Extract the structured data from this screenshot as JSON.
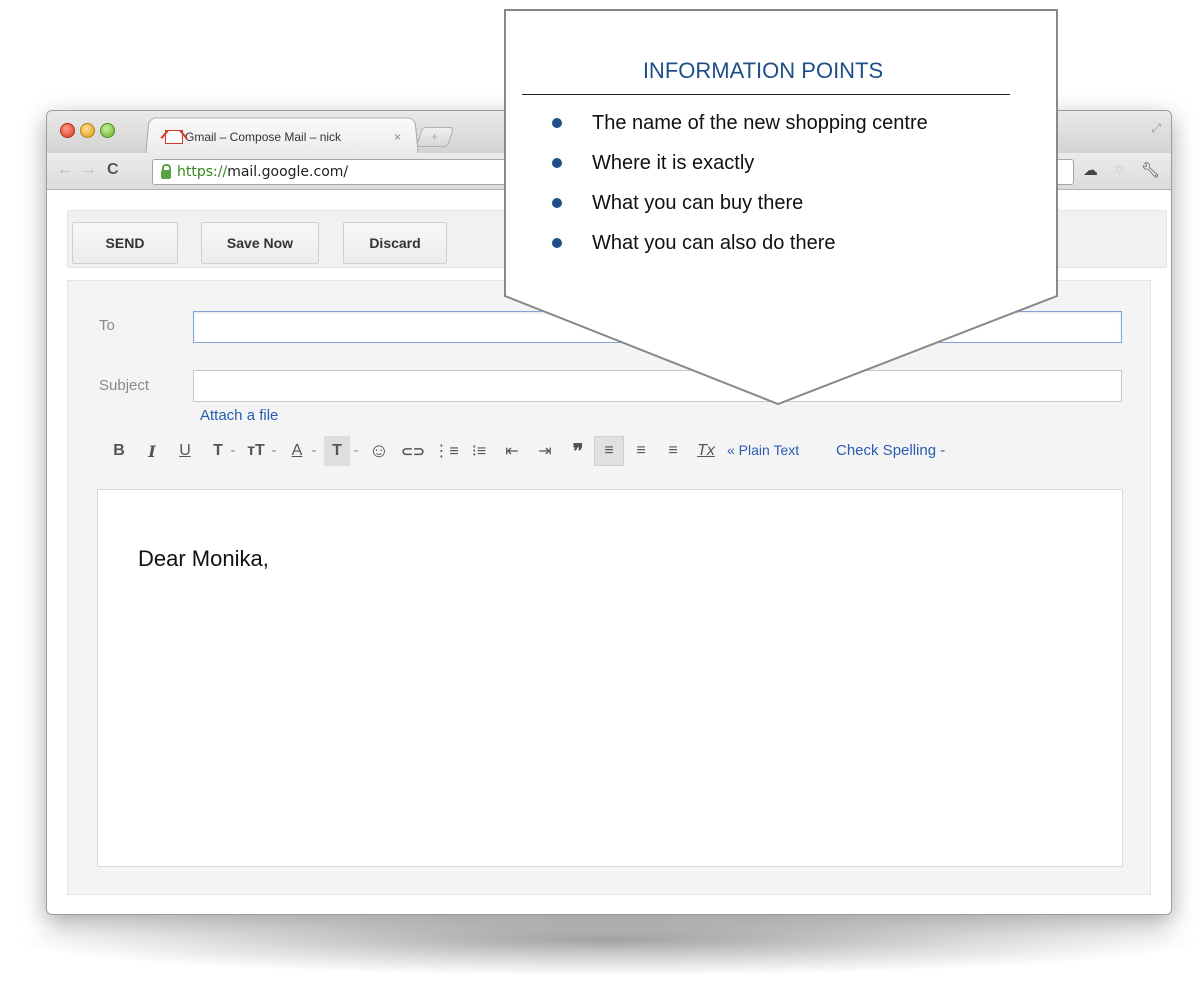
{
  "browser": {
    "tab_title": "Gmail – Compose Mail – nick",
    "tab_close": "×",
    "new_tab": "+",
    "url_scheme": "https://",
    "url_host": "mail.google.com/"
  },
  "compose": {
    "buttons": {
      "send": "SEND",
      "save": "Save Now",
      "discard": "Discard"
    },
    "to_label": "To",
    "to_value": "",
    "subject_label": "Subject",
    "subject_value": "",
    "attach_link": "Attach a file",
    "format": {
      "bold": "B",
      "italic": "I",
      "underline": "U",
      "font": "T",
      "font_caret": "-",
      "size": "ᴛT",
      "size_caret": "-",
      "text_color": "A",
      "text_color_caret": "-",
      "highlight": "T",
      "highlight_caret": "-",
      "emoji": "☺",
      "link": "⊂⊃",
      "numbered_list": "⋮≡",
      "bullet_list": "⁝≡",
      "indent_less": "⇤",
      "indent_more": "⇥",
      "quote": "❞",
      "align_left": "≡",
      "align_center": "≡",
      "align_right": "≡",
      "remove_format": "Tx",
      "plain_text": "« Plain Text",
      "check_spelling": "Check Spelling -"
    },
    "body_text": "Dear Monika,"
  },
  "callout": {
    "title": "INFORMATION POINTS",
    "items": [
      "The name of the new shopping centre",
      "Where it is exactly",
      "What you can buy there",
      "What you can also do there"
    ]
  },
  "colors": {
    "callout_title": "#1f4f8a",
    "link": "#2a5db0",
    "url_scheme": "#38861f"
  }
}
